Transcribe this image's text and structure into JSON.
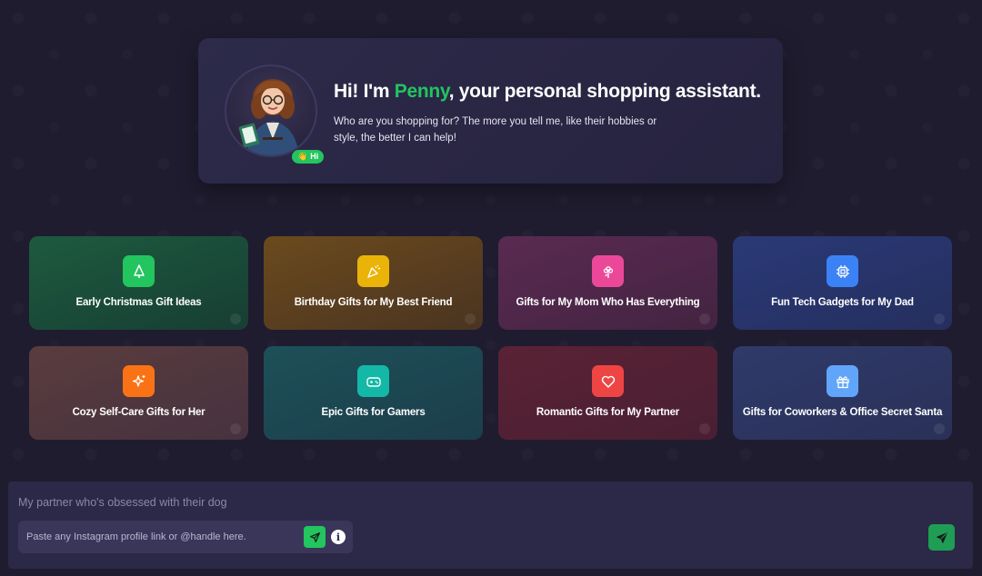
{
  "hero": {
    "title_prefix": "Hi! I'm ",
    "name": "Penny",
    "title_suffix": ", your personal shopping assistant.",
    "subtitle": "Who are you shopping for? The more you tell me, like their hobbies or style, the better I can help!",
    "badge_emoji": "👋",
    "badge_text": "Hi",
    "accent_color": "#22c55e"
  },
  "suggestions": [
    {
      "label": "Early Christmas Gift Ideas",
      "icon": "christmas-tree-icon",
      "color": "#22c55e"
    },
    {
      "label": "Birthday Gifts for My Best Friend",
      "icon": "party-popper-icon",
      "color": "#eab308"
    },
    {
      "label": "Gifts for My Mom Who Has Everything",
      "icon": "flower-icon",
      "color": "#ec4899"
    },
    {
      "label": "Fun Tech Gadgets for My Dad",
      "icon": "cpu-chip-icon",
      "color": "#3b82f6"
    },
    {
      "label": "Cozy Self-Care Gifts for Her",
      "icon": "sparkles-icon",
      "color": "#f97316"
    },
    {
      "label": "Epic Gifts for Gamers",
      "icon": "gamepad-icon",
      "color": "#14b8a6"
    },
    {
      "label": "Romantic Gifts for My Partner",
      "icon": "heart-icon",
      "color": "#ef4444"
    },
    {
      "label": "Gifts for Coworkers & Office Secret Santa",
      "icon": "gift-icon",
      "color": "#60a5fa"
    }
  ],
  "composer": {
    "prompt_placeholder": "My partner who's obsessed with their dog",
    "instagram_placeholder": "Paste any Instagram profile link or @handle here.",
    "info_label": "i"
  }
}
